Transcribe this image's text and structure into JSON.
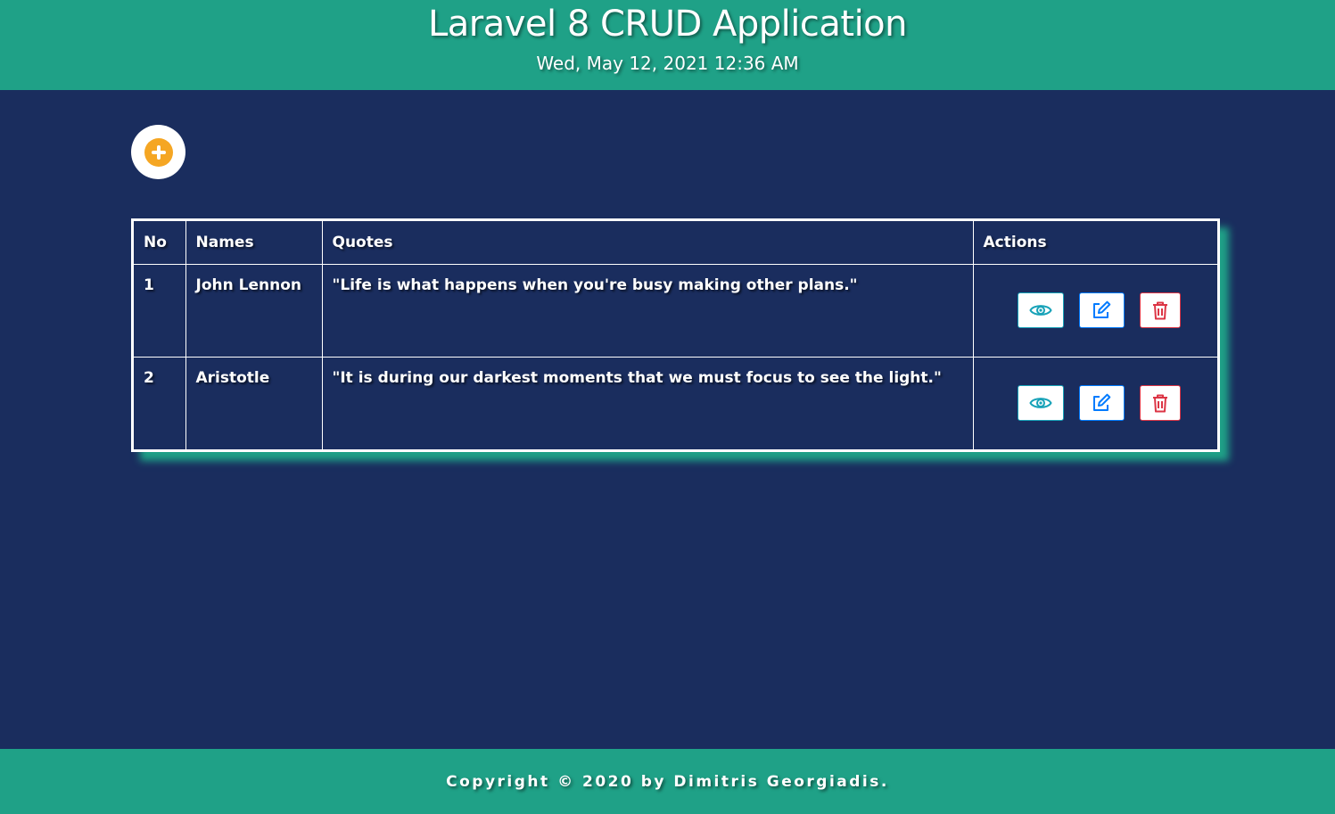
{
  "header": {
    "title": "Laravel 8 CRUD Application",
    "datetime": "Wed, May 12, 2021 12:36 AM"
  },
  "add_button": {
    "icon": "plus-circle-icon",
    "color": "#f5a623"
  },
  "table": {
    "headers": {
      "no": "No",
      "names": "Names",
      "quotes": "Quotes",
      "actions": "Actions"
    },
    "rows": [
      {
        "no": "1",
        "name": "John Lennon",
        "quote": "\"Life is what happens when you're busy making other plans.\""
      },
      {
        "no": "2",
        "name": "Aristotle",
        "quote": "\"It is during our darkest moments that we must focus to see the light.\""
      }
    ],
    "action_icons": [
      "eye-icon",
      "edit-icon",
      "trash-icon"
    ]
  },
  "footer": {
    "copyright": "Copyright © 2020 by Dimitris Georgiadis."
  },
  "colors": {
    "background": "#1a2d5e",
    "accent": "#1fa187",
    "view": "#17a2b8",
    "edit": "#007bff",
    "delete": "#dc3545"
  }
}
